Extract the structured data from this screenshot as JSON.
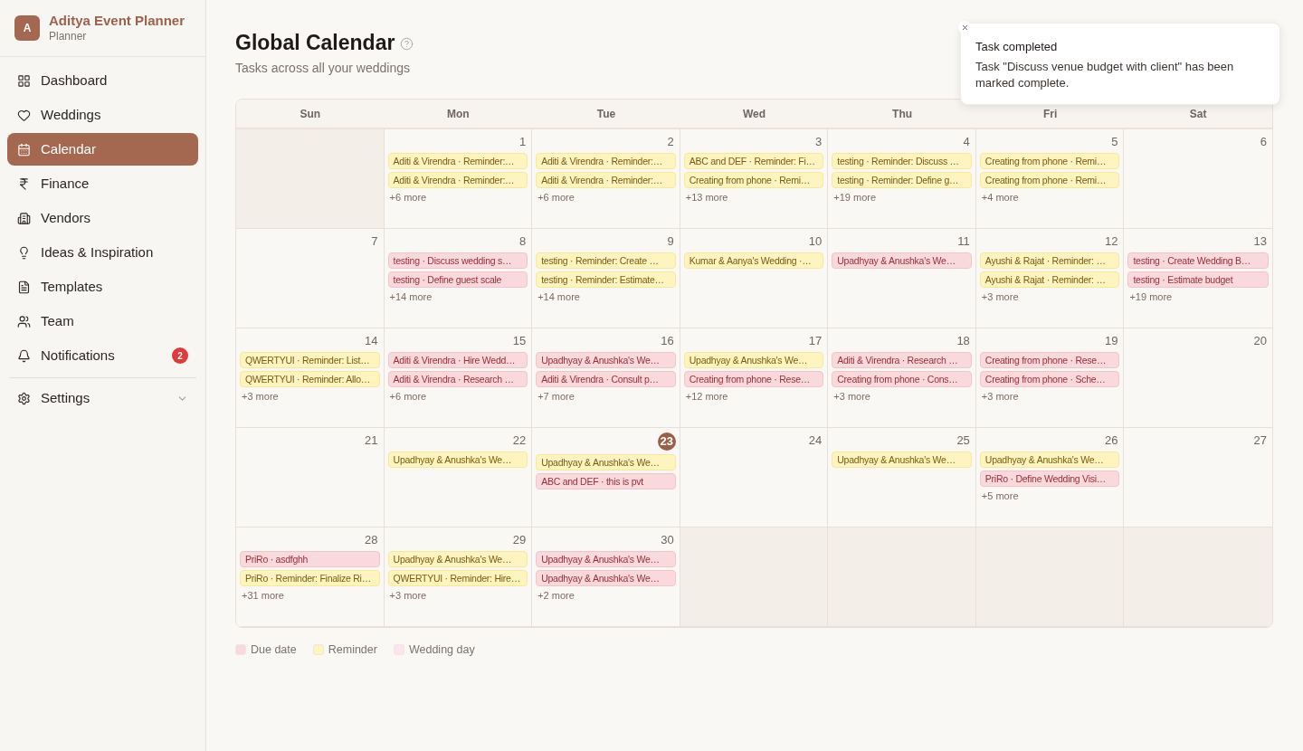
{
  "sidebar": {
    "brand": {
      "initial": "A",
      "name": "Aditya Event Planner",
      "role": "Planner"
    },
    "items": [
      {
        "label": "Dashboard",
        "selected": false
      },
      {
        "label": "Weddings",
        "selected": false
      },
      {
        "label": "Calendar",
        "selected": true
      },
      {
        "label": "Finance",
        "selected": false
      },
      {
        "label": "Vendors",
        "selected": false
      },
      {
        "label": "Ideas & Inspiration",
        "selected": false
      },
      {
        "label": "Templates",
        "selected": false
      },
      {
        "label": "Team",
        "selected": false
      },
      {
        "label": "Notifications",
        "selected": false,
        "badge": "2"
      }
    ],
    "settings": {
      "label": "Settings",
      "expanded": false
    }
  },
  "header": {
    "title": "Global Calendar",
    "subtitle": "Tasks across all your weddings"
  },
  "calendar": {
    "weekdays": [
      "Sun",
      "Mon",
      "Tue",
      "Wed",
      "Thu",
      "Fri",
      "Sat"
    ],
    "days": [
      {
        "blank": true
      },
      {
        "blank": false,
        "date": "1",
        "today": false,
        "events": [
          {
            "text": "Aditi & Virendra · Reminder:…",
            "kind": "reminder"
          },
          {
            "text": "Aditi & Virendra · Reminder:…",
            "kind": "reminder"
          }
        ],
        "more": "+6 more"
      },
      {
        "blank": false,
        "date": "2",
        "today": false,
        "events": [
          {
            "text": "Aditi & Virendra · Reminder:…",
            "kind": "reminder"
          },
          {
            "text": "Aditi & Virendra · Reminder:…",
            "kind": "reminder"
          }
        ],
        "more": "+6 more"
      },
      {
        "blank": false,
        "date": "3",
        "today": false,
        "events": [
          {
            "text": "ABC and DEF · Reminder: Fi…",
            "kind": "reminder"
          },
          {
            "text": "Creating from phone · Remi…",
            "kind": "reminder"
          }
        ],
        "more": "+13 more"
      },
      {
        "blank": false,
        "date": "4",
        "today": false,
        "events": [
          {
            "text": "testing · Reminder: Discuss …",
            "kind": "reminder"
          },
          {
            "text": "testing · Reminder: Define g…",
            "kind": "reminder"
          }
        ],
        "more": "+19 more"
      },
      {
        "blank": false,
        "date": "5",
        "today": false,
        "events": [
          {
            "text": "Creating from phone · Remi…",
            "kind": "reminder"
          },
          {
            "text": "Creating from phone · Remi…",
            "kind": "reminder"
          }
        ],
        "more": "+4 more"
      },
      {
        "blank": false,
        "date": "6",
        "today": false
      },
      {
        "blank": false,
        "date": "7",
        "today": false
      },
      {
        "blank": false,
        "date": "8",
        "today": false,
        "events": [
          {
            "text": "testing · Discuss wedding s…",
            "kind": "due"
          },
          {
            "text": "testing · Define guest scale",
            "kind": "due"
          }
        ],
        "more": "+14 more"
      },
      {
        "blank": false,
        "date": "9",
        "today": false,
        "events": [
          {
            "text": "testing · Reminder: Create …",
            "kind": "reminder"
          },
          {
            "text": "testing · Reminder: Estimate…",
            "kind": "reminder"
          }
        ],
        "more": "+14 more"
      },
      {
        "blank": false,
        "date": "10",
        "today": false,
        "events": [
          {
            "text": "Kumar & Aanya's Wedding ·…",
            "kind": "reminder"
          }
        ]
      },
      {
        "blank": false,
        "date": "11",
        "today": false,
        "events": [
          {
            "text": "Upadhyay & Anushka's We…",
            "kind": "due"
          }
        ]
      },
      {
        "blank": false,
        "date": "12",
        "today": false,
        "events": [
          {
            "text": "Ayushi & Rajat · Reminder: …",
            "kind": "reminder"
          },
          {
            "text": "Ayushi & Rajat · Reminder: …",
            "kind": "reminder"
          }
        ],
        "more": "+3 more"
      },
      {
        "blank": false,
        "date": "13",
        "today": false,
        "events": [
          {
            "text": "testing · Create Wedding B…",
            "kind": "due"
          },
          {
            "text": "testing · Estimate budget",
            "kind": "due"
          }
        ],
        "more": "+19 more"
      },
      {
        "blank": false,
        "date": "14",
        "today": false,
        "events": [
          {
            "text": "QWERTYUI · Reminder: List…",
            "kind": "reminder"
          },
          {
            "text": "QWERTYUI · Reminder: Allo…",
            "kind": "reminder"
          }
        ],
        "more": "+3 more"
      },
      {
        "blank": false,
        "date": "15",
        "today": false,
        "events": [
          {
            "text": "Aditi & Virendra · Hire Wedd…",
            "kind": "due"
          },
          {
            "text": "Aditi & Virendra · Research …",
            "kind": "due"
          }
        ],
        "more": "+6 more"
      },
      {
        "blank": false,
        "date": "16",
        "today": false,
        "events": [
          {
            "text": "Upadhyay & Anushka's We…",
            "kind": "due"
          },
          {
            "text": "Aditi & Virendra · Consult p…",
            "kind": "due"
          }
        ],
        "more": "+7 more"
      },
      {
        "blank": false,
        "date": "17",
        "today": false,
        "events": [
          {
            "text": "Upadhyay & Anushka's We…",
            "kind": "reminder"
          },
          {
            "text": "Creating from phone · Rese…",
            "kind": "due"
          }
        ],
        "more": "+12 more"
      },
      {
        "blank": false,
        "date": "18",
        "today": false,
        "events": [
          {
            "text": "Aditi & Virendra · Research …",
            "kind": "due"
          },
          {
            "text": "Creating from phone · Cons…",
            "kind": "due"
          }
        ],
        "more": "+3 more"
      },
      {
        "blank": false,
        "date": "19",
        "today": false,
        "events": [
          {
            "text": "Creating from phone · Rese…",
            "kind": "due"
          },
          {
            "text": "Creating from phone · Sche…",
            "kind": "due"
          }
        ],
        "more": "+3 more"
      },
      {
        "blank": false,
        "date": "20",
        "today": false
      },
      {
        "blank": false,
        "date": "21",
        "today": false
      },
      {
        "blank": false,
        "date": "22",
        "today": false,
        "events": [
          {
            "text": "Upadhyay & Anushka's We…",
            "kind": "reminder"
          }
        ]
      },
      {
        "blank": false,
        "date": "23",
        "today": true,
        "events": [
          {
            "text": "Upadhyay & Anushka's We…",
            "kind": "reminder"
          },
          {
            "text": "ABC and DEF · this is pvt",
            "kind": "due"
          }
        ]
      },
      {
        "blank": false,
        "date": "24",
        "today": false
      },
      {
        "blank": false,
        "date": "25",
        "today": false,
        "events": [
          {
            "text": "Upadhyay & Anushka's We…",
            "kind": "reminder"
          }
        ]
      },
      {
        "blank": false,
        "date": "26",
        "today": false,
        "events": [
          {
            "text": "Upadhyay & Anushka's We…",
            "kind": "reminder"
          },
          {
            "text": "PriRo · Define Wedding Visi…",
            "kind": "due"
          }
        ],
        "more": "+5 more"
      },
      {
        "blank": false,
        "date": "27",
        "today": false
      },
      {
        "blank": false,
        "date": "28",
        "today": false,
        "events": [
          {
            "text": "PriRo · asdfghh",
            "kind": "due"
          },
          {
            "text": "PriRo · Reminder: Finalize Ri…",
            "kind": "reminder"
          }
        ],
        "more": "+31 more"
      },
      {
        "blank": false,
        "date": "29",
        "today": false,
        "events": [
          {
            "text": "Upadhyay & Anushka's We…",
            "kind": "reminder"
          },
          {
            "text": "QWERTYUI · Reminder: Hire…",
            "kind": "reminder"
          }
        ],
        "more": "+3 more"
      },
      {
        "blank": false,
        "date": "30",
        "today": false,
        "events": [
          {
            "text": "Upadhyay & Anushka's We…",
            "kind": "due"
          },
          {
            "text": "Upadhyay & Anushka's We…",
            "kind": "due"
          }
        ],
        "more": "+2 more"
      },
      {
        "blank": true
      },
      {
        "blank": true
      },
      {
        "blank": true
      },
      {
        "blank": true
      }
    ]
  },
  "legend": [
    {
      "label": "Due date",
      "color": "#fad9dc"
    },
    {
      "label": "Reminder",
      "color": "#fdf4bf"
    },
    {
      "label": "Wedding day",
      "color": "#fce4ee"
    }
  ],
  "toast": {
    "title": "Task completed",
    "message": "Task \"Discuss venue budget with client\" has been marked complete."
  }
}
